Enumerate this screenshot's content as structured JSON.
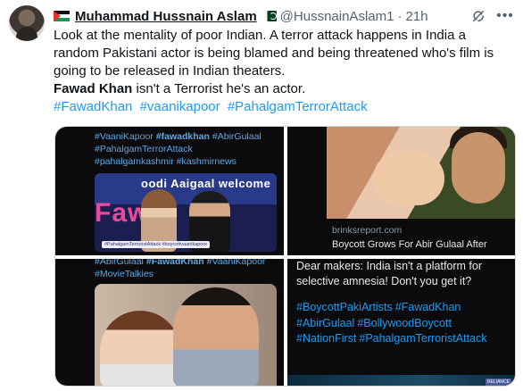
{
  "tweet": {
    "display_name": "Muhammad Hussnain Aslam",
    "handle": "@HussnainAslam1",
    "separator": "·",
    "time": "21h",
    "lines": [
      "Look at the mentality of poor Indian. A terror attack happens in India a",
      "random Pakistani actor is being blamed and being threatened who's film is",
      "going to be released in Indian theaters."
    ],
    "bold_name": "Fawad Khan",
    "last_line_rest": " isn't a Terrorist he's an actor.",
    "hashtags": [
      "#FawadKhan",
      "#vaanikapoor",
      "#PahalgamTerrorAttack"
    ]
  },
  "media": {
    "cell1": {
      "tags_line1": [
        "#VaaniKapoor"
      ],
      "tags_line1_bold": "#fawadkhan",
      "tags_line1_rest": "#AbirGulaal",
      "tags_line2": [
        "#PahalgamTerrorAttack"
      ],
      "tags_line3": [
        "#pahalgamkashmir",
        "#kashmirnews"
      ],
      "banner": "oodi Aaigaal welcome",
      "pink_text": "Faw",
      "caption": "#PahalgamTerroristAttack #boycottvaanikapoor"
    },
    "cell2": {
      "source": "brinksreport.com",
      "headline": "Boycott Grows For Abir Gulaal After"
    },
    "cell3": {
      "tags_line1": "#AbirGulaal",
      "tags_line1_bold": "#FawadKhan",
      "tags_line1_rest": "#VaaniKapoor",
      "tags_line2": "#MovieTalkies"
    },
    "cell4": {
      "text_line1": "Dear makers: India isn't a platform for",
      "text_line2": "selective amnesia! Don't you get it?",
      "tags": [
        "#BoycottPakiArtists",
        "#FawadKhan",
        "#AbirGulaal",
        "#BollywoodBoycott",
        "#NationFirst",
        "#PahalgamTerroristAttack"
      ],
      "badge": "RELIANCE"
    }
  },
  "icons": {
    "grok": "grok-icon",
    "more": "more-icon",
    "flag": "palestine-flag-icon",
    "pk_flag": "pakistan-flag-icon"
  }
}
